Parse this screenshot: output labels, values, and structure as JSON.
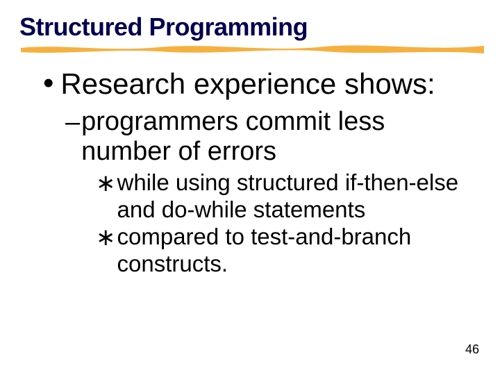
{
  "title": "Structured Programming",
  "bullets": {
    "level1": {
      "text": "Research experience shows:"
    },
    "level2": {
      "text": "programmers commit less number of errors"
    },
    "level3a": {
      "text": "while using structured if-then-else and  do-while statements"
    },
    "level3b": {
      "text": "compared to  test-and-branch constructs."
    }
  },
  "page_number": "46"
}
